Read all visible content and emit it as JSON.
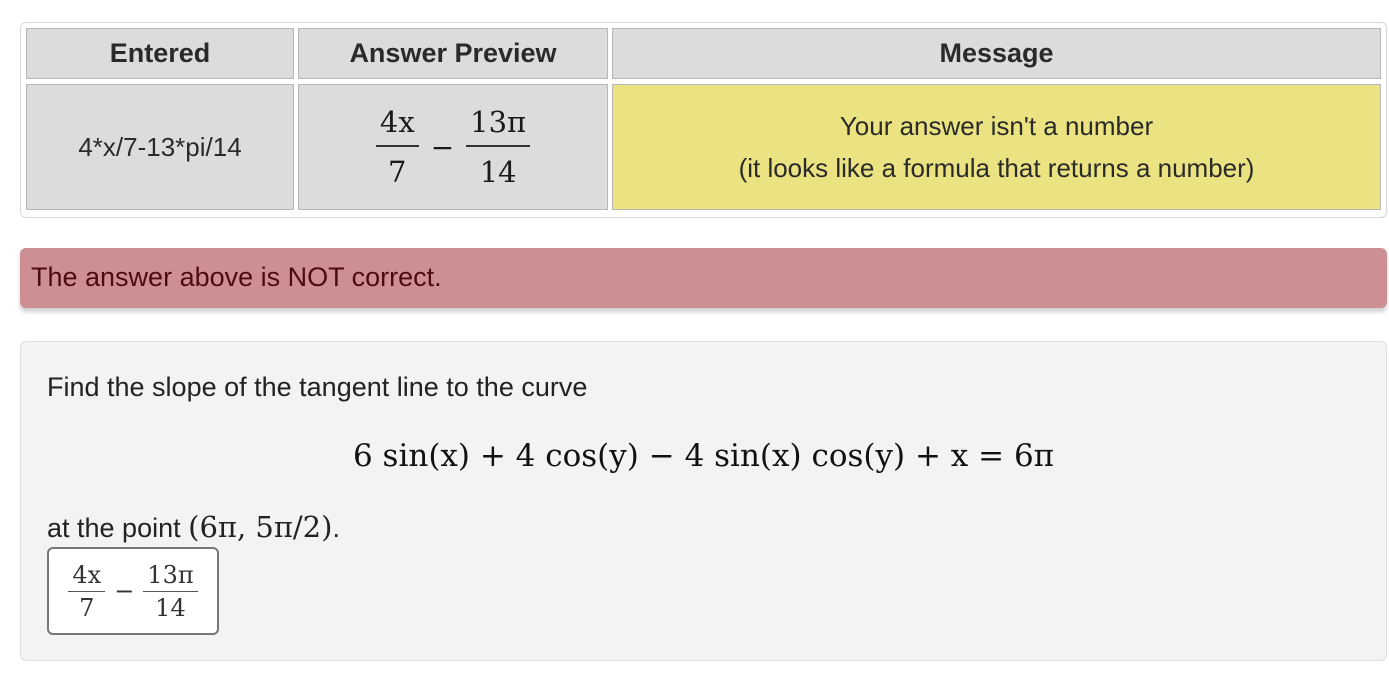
{
  "results_table": {
    "headers": {
      "entered": "Entered",
      "preview": "Answer Preview",
      "message": "Message"
    },
    "row": {
      "entered": "4*x/7-13*pi/14",
      "preview": {
        "term1_num": "4x",
        "term1_den": "7",
        "operator": "−",
        "term2_num": "13π",
        "term2_den": "14"
      },
      "message_line1": "Your answer isn't a number",
      "message_line2": "(it looks like a formula that returns a number)"
    }
  },
  "feedback": {
    "text": "The answer above is NOT correct."
  },
  "problem": {
    "prompt": "Find the slope of the tangent line to the curve",
    "equation": "6 sin(x) + 4 cos(y) − 4 sin(x) cos(y) + x = 6π",
    "point_prefix": "at the point",
    "point": "(6π, 5π/2)",
    "point_suffix": ".",
    "answer_input": {
      "term1_num": "4x",
      "term1_den": "7",
      "operator": "−",
      "term2_num": "13π",
      "term2_den": "14"
    }
  },
  "colors": {
    "header_bg": "#dcdcdc",
    "message_bg": "#ebe381",
    "feedback_bg": "#cd9092",
    "feedback_text": "#4a0c0f",
    "panel_bg": "#f3f3f3"
  }
}
